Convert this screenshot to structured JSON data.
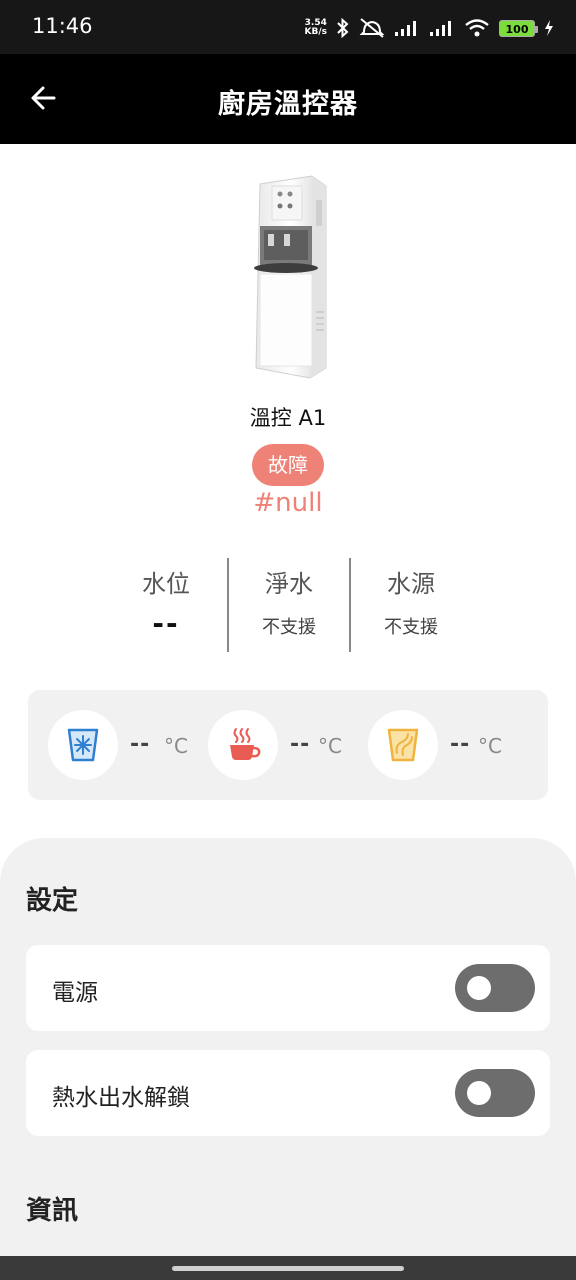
{
  "status_bar": {
    "time": "11:46",
    "net_speed_value": "3.54",
    "net_speed_unit": "KB/s",
    "battery": "100"
  },
  "header": {
    "title": "廚房溫控器",
    "back_icon": "arrow-left-icon"
  },
  "device": {
    "name": "溫控 A1",
    "status": "故障",
    "status_color": "#ee8277",
    "error_code": "#null"
  },
  "stats": [
    {
      "label": "水位",
      "value": "--"
    },
    {
      "label": "淨水",
      "value": "不支援"
    },
    {
      "label": "水源",
      "value": "不支援"
    }
  ],
  "temperatures": [
    {
      "icon": "ice-water-icon",
      "value": "--",
      "unit": "°C",
      "color": "#2f7fd3"
    },
    {
      "icon": "hot-coffee-icon",
      "value": "--",
      "unit": "°C",
      "color": "#e85c53"
    },
    {
      "icon": "warm-water-icon",
      "value": "--",
      "unit": "°C",
      "color": "#f0b33d"
    }
  ],
  "settings": {
    "title": "設定",
    "items": [
      {
        "label": "電源",
        "on": false
      },
      {
        "label": "熱水出水解鎖",
        "on": false
      }
    ]
  },
  "info": {
    "title": "資訊"
  }
}
